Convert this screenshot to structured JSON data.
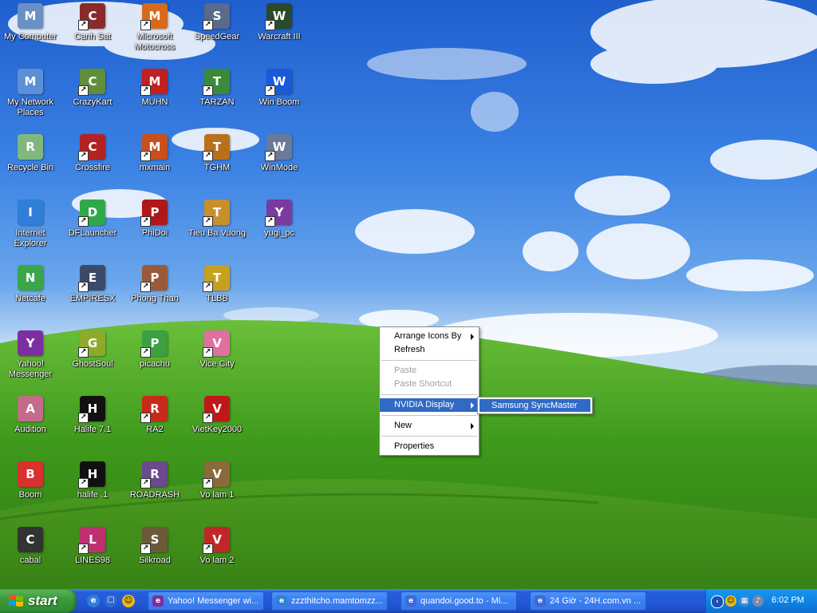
{
  "desktop_icons": [
    {
      "label": "My Computer",
      "icon": "computer-icon",
      "color": "#6a8fc4",
      "shortcut": false
    },
    {
      "label": "My Network Places",
      "icon": "network-places-icon",
      "color": "#5b8fd6",
      "shortcut": false
    },
    {
      "label": "Recycle Bin",
      "icon": "recycle-bin-icon",
      "color": "#7fb87f",
      "shortcut": false
    },
    {
      "label": "Internet Explorer",
      "icon": "internet-explorer-icon",
      "color": "#2f7fd8",
      "shortcut": false
    },
    {
      "label": "Netcafe",
      "icon": "netcafe-icon",
      "color": "#3aa64a",
      "shortcut": false
    },
    {
      "label": "Yahoo! Messenger",
      "icon": "yahoo-messenger-icon",
      "color": "#7b2fa0",
      "shortcut": false
    },
    {
      "label": "Audition",
      "icon": "audition-icon",
      "color": "#c46b8c",
      "shortcut": false
    },
    {
      "label": "Boom",
      "icon": "boom-icon",
      "color": "#d93030",
      "shortcut": false
    },
    {
      "label": "cabal",
      "icon": "cabal-icon",
      "color": "#333333",
      "shortcut": false
    },
    {
      "label": "Canh Sat",
      "icon": "canh-sat-icon",
      "color": "#8b2a2a",
      "shortcut": true
    },
    {
      "label": "CrazyKart",
      "icon": "crazykart-icon",
      "color": "#5f8f3a",
      "shortcut": true
    },
    {
      "label": "Crossfire",
      "icon": "crossfire-icon",
      "color": "#b22222",
      "shortcut": true
    },
    {
      "label": "DFLauncher",
      "icon": "dflauncher-icon",
      "color": "#2fa84a",
      "shortcut": true
    },
    {
      "label": "EMPIRESX",
      "icon": "empiresx-icon",
      "color": "#3b4a6b",
      "shortcut": true
    },
    {
      "label": "GhostSoul",
      "icon": "ghostsoul-icon",
      "color": "#8faa2a",
      "shortcut": true
    },
    {
      "label": "Halife 7.1",
      "icon": "halflife-icon",
      "color": "#111111",
      "shortcut": true
    },
    {
      "label": "halife .1",
      "icon": "halflife-icon-2",
      "color": "#111111",
      "shortcut": true
    },
    {
      "label": "LINES98",
      "icon": "lines98-icon",
      "color": "#c03070",
      "shortcut": true
    },
    {
      "label": "Microsoft Motocross",
      "icon": "motocross-icon",
      "color": "#d86a1a",
      "shortcut": true
    },
    {
      "label": "MUHN",
      "icon": "muhn-icon",
      "color": "#c02020",
      "shortcut": true
    },
    {
      "label": "mxmain",
      "icon": "mxmain-icon",
      "color": "#c8501a",
      "shortcut": true
    },
    {
      "label": "PhiDoi",
      "icon": "phidoi-icon",
      "color": "#b01818",
      "shortcut": true
    },
    {
      "label": "Phong Than",
      "icon": "phong-than-icon",
      "color": "#9a5a3a",
      "shortcut": true
    },
    {
      "label": "picachu",
      "icon": "picachu-icon",
      "color": "#3aa040",
      "shortcut": true
    },
    {
      "label": "RA2",
      "icon": "ra2-icon",
      "color": "#c82a1a",
      "shortcut": true
    },
    {
      "label": "ROADRASH",
      "icon": "roadrash-icon",
      "color": "#6a4a8a",
      "shortcut": true
    },
    {
      "label": "Silkroad",
      "icon": "silkroad-icon",
      "color": "#6a5a3a",
      "shortcut": true
    },
    {
      "label": "SpeedGear",
      "icon": "speedgear-icon",
      "color": "#5a6a8a",
      "shortcut": true
    },
    {
      "label": "TARZAN",
      "icon": "tarzan-icon",
      "color": "#3a8a3a",
      "shortcut": true
    },
    {
      "label": "TGHM",
      "icon": "tghm-icon",
      "color": "#b8701a",
      "shortcut": true
    },
    {
      "label": "Tieu Ba Vuong",
      "icon": "tieu-ba-vuong-icon",
      "color": "#c8902a",
      "shortcut": true
    },
    {
      "label": "TLBB",
      "icon": "tlbb-icon",
      "color": "#c8a020",
      "shortcut": true
    },
    {
      "label": "Vice City",
      "icon": "vice-city-icon",
      "color": "#e070a0",
      "shortcut": true
    },
    {
      "label": "VietKey2000",
      "icon": "vietkey-icon",
      "color": "#c01818",
      "shortcut": true
    },
    {
      "label": "Vo lam 1",
      "icon": "vo-lam-1-icon",
      "color": "#8a6a3a",
      "shortcut": true
    },
    {
      "label": "Vo lam 2",
      "icon": "vo-lam-2-icon",
      "color": "#c02828",
      "shortcut": true
    },
    {
      "label": "Warcraft III",
      "icon": "warcraft-icon",
      "color": "#2a4a2a",
      "shortcut": true
    },
    {
      "label": "Win Boom",
      "icon": "win-boom-icon",
      "color": "#1a5ad8",
      "shortcut": true
    },
    {
      "label": "WinMode",
      "icon": "winmode-icon",
      "color": "#6a7a9a",
      "shortcut": true
    },
    {
      "label": "yugi_pc",
      "icon": "yugi-icon",
      "color": "#7a3aa0",
      "shortcut": true
    }
  ],
  "context_menu": {
    "arrange_icons_by": "Arrange Icons By",
    "refresh": "Refresh",
    "paste": "Paste",
    "paste_shortcut": "Paste Shortcut",
    "nvidia_display": "NVIDIA Display",
    "new": "New",
    "properties": "Properties",
    "highlight_color": "#316ac5"
  },
  "submenu": {
    "samsung_syncmaster": "Samsung SyncMaster"
  },
  "taskbar": {
    "start_label": "start",
    "tasks": [
      {
        "label": "Yahoo! Messenger wi...",
        "icon": "yahoo-messenger-icon",
        "color": "#7b2fa0"
      },
      {
        "label": "zzzthitcho.mamtomzz...",
        "icon": "internet-explorer-icon",
        "color": "#2f7fd8"
      },
      {
        "label": "quandoi.good.to - Mi...",
        "icon": "browser-icon",
        "color": "#3a6ad8"
      },
      {
        "label": "24 Giờ - 24H.com.vn ...",
        "icon": "browser-icon-2",
        "color": "#3a6ad8"
      }
    ],
    "clock": "6:02 PM",
    "start_color": "#3c9a3c"
  }
}
